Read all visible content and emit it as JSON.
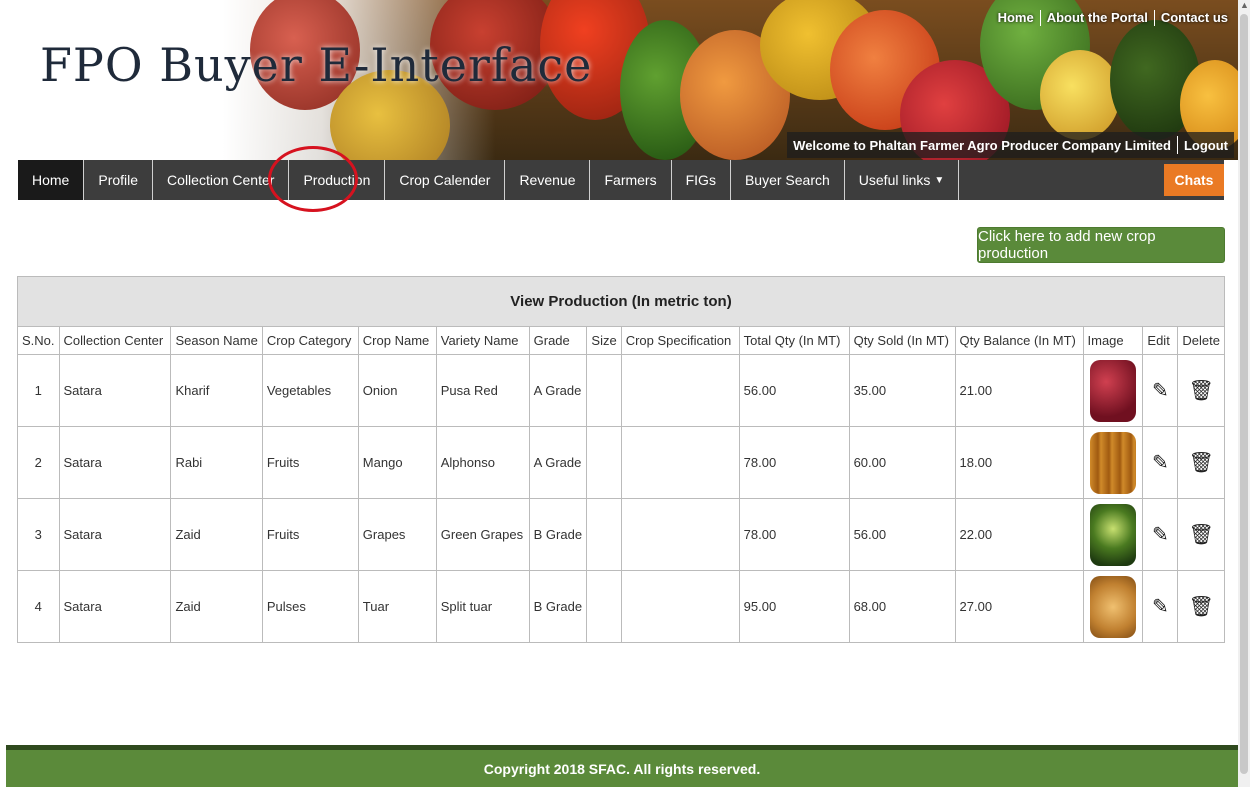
{
  "banner": {
    "title": "FPO Buyer E-Interface",
    "top_links": [
      "Home",
      "About the Portal",
      "Contact us"
    ],
    "welcome": "Welcome to Phaltan Farmer Agro Producer Company Limited",
    "logout": "Logout"
  },
  "nav": {
    "items": [
      "Home",
      "Profile",
      "Collection Center",
      "Production",
      "Crop Calender",
      "Revenue",
      "Farmers",
      "FIGs",
      "Buyer Search",
      "Useful links"
    ],
    "active": "Home",
    "chats": "Chats"
  },
  "add_button": "Click here to add new crop production",
  "table": {
    "caption": "View Production (In metric ton)",
    "headers": [
      "S.No.",
      "Collection Center",
      "Season Name",
      "Crop Category",
      "Crop Name",
      "Variety Name",
      "Grade",
      "Size",
      "Crop Specification",
      "Total Qty (In MT)",
      "Qty Sold (In MT)",
      "Qty Balance (In MT)",
      "Image",
      "Edit",
      "Delete"
    ],
    "rows": [
      {
        "sno": "1",
        "center": "Satara",
        "season": "Kharif",
        "category": "Vegetables",
        "crop": "Onion",
        "variety": "Pusa Red",
        "grade": "A Grade",
        "size": "",
        "spec": "",
        "total": "56.00",
        "sold": "35.00",
        "balance": "21.00",
        "image_icon": "onion-image",
        "image_color": "#a82a2a"
      },
      {
        "sno": "2",
        "center": "Satara",
        "season": "Rabi",
        "category": "Fruits",
        "crop": "Mango",
        "variety": "Alphonso",
        "grade": "A Grade",
        "size": "",
        "spec": "",
        "total": "78.00",
        "sold": "60.00",
        "balance": "18.00",
        "image_icon": "mango-image",
        "image_color": "#c07a20"
      },
      {
        "sno": "3",
        "center": "Satara",
        "season": "Zaid",
        "category": "Fruits",
        "crop": "Grapes",
        "variety": "Green Grapes",
        "grade": "B Grade",
        "size": "",
        "spec": "",
        "total": "78.00",
        "sold": "56.00",
        "balance": "22.00",
        "image_icon": "grapes-image",
        "image_color": "#5a8a2a"
      },
      {
        "sno": "4",
        "center": "Satara",
        "season": "Zaid",
        "category": "Pulses",
        "crop": "Tuar",
        "variety": "Split tuar",
        "grade": "B Grade",
        "size": "",
        "spec": "",
        "total": "95.00",
        "sold": "68.00",
        "balance": "27.00",
        "image_icon": "tuar-image",
        "image_color": "#d4a050"
      }
    ]
  },
  "footer": "Copyright 2018 SFAC. All rights reserved.",
  "colors": {
    "nav_bg": "#3d3d3d",
    "chats": "#ea7a24",
    "add_button": "#5a8a3a",
    "footer": "#5b8a3a",
    "highlight": "#d6121f"
  }
}
